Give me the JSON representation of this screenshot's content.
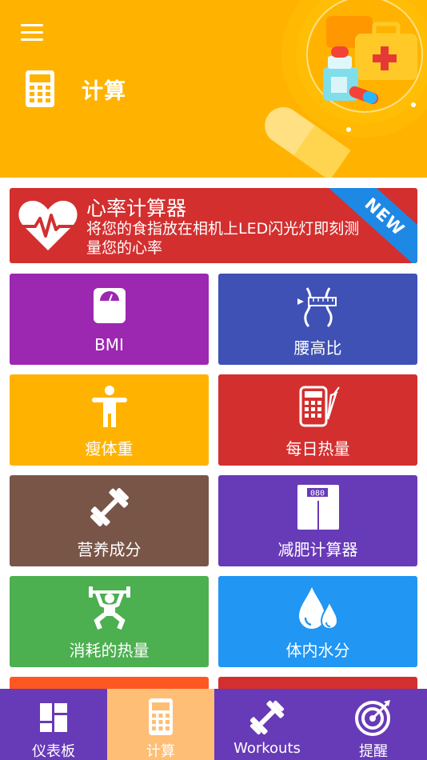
{
  "header": {
    "title": "计算",
    "bg_color": "#FFB300"
  },
  "feature_card": {
    "title": "心率计算器",
    "description": "将您的食指放在相机上LED闪光灯即刻测量您的心率",
    "badge": "NEW",
    "bg_color": "#D32F2F",
    "badge_color": "#1E88E5"
  },
  "tiles": [
    {
      "label": "BMI",
      "icon": "scale-icon",
      "color": "#9C27B0"
    },
    {
      "label": "腰高比",
      "icon": "waist-tape-icon",
      "color": "#3F51B5"
    },
    {
      "label": "瘦体重",
      "icon": "person-icon",
      "color": "#FFB300"
    },
    {
      "label": "每日热量",
      "icon": "calorie-calculator-icon",
      "color": "#D32F2F"
    },
    {
      "label": "营养成分",
      "icon": "dumbbell-icon",
      "color": "#795548"
    },
    {
      "label": "减肥计算器",
      "icon": "weight-scale-icon",
      "color": "#673AB7"
    },
    {
      "label": "消耗的热量",
      "icon": "weightlifter-icon",
      "color": "#4CAF50"
    },
    {
      "label": "体内水分",
      "icon": "water-drops-icon",
      "color": "#2196F3"
    }
  ],
  "scale_reading": "080",
  "peek_row_colors": [
    "#FF5722",
    "#D32F2F"
  ],
  "tab_bar": {
    "bg_color": "#673AB7",
    "active_color": "#FFBE75",
    "tabs": [
      {
        "label": "仪表板",
        "icon": "dashboard-icon",
        "active": false
      },
      {
        "label": "计算",
        "icon": "calculator-icon",
        "active": true
      },
      {
        "label": "Workouts",
        "icon": "dumbbell-icon",
        "active": false
      },
      {
        "label": "提醒",
        "icon": "target-icon",
        "active": false
      }
    ]
  }
}
